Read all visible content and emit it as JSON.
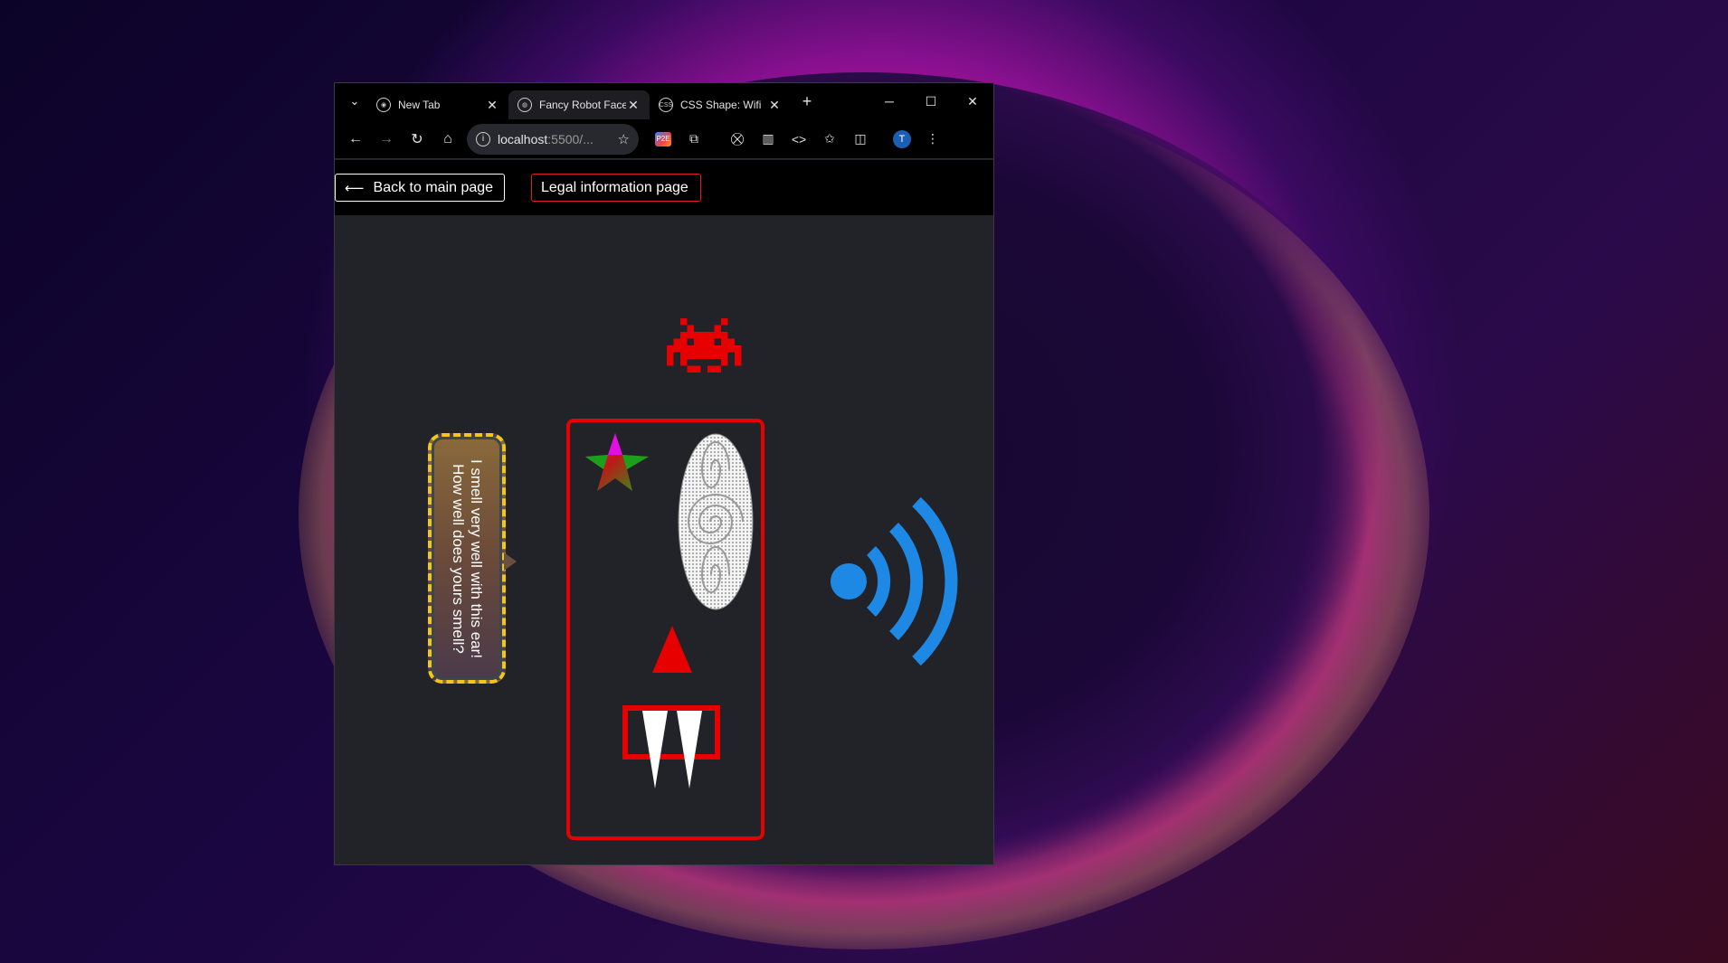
{
  "browser": {
    "tabs": [
      {
        "label": "New Tab",
        "favicon": "chrome-icon",
        "active": false
      },
      {
        "label": "Fancy Robot Face",
        "favicon": "globe-icon",
        "active": true
      },
      {
        "label": "CSS Shape: Wifi",
        "favicon": "css-icon",
        "active": false
      }
    ],
    "address": {
      "host": "localhost",
      "rest": ":5500/..."
    },
    "profile_initial": "T",
    "extension_badge": "P2E"
  },
  "page": {
    "back_button": "Back to main page",
    "back_arrow": "⟵",
    "legal_button": "Legal information page",
    "speech_bubble_text": "I smell very well with this ear! How well does yours smell?"
  },
  "colors": {
    "accent_red": "#e60000",
    "wifi_blue": "#1e88e5",
    "bubble_border": "#f5c518",
    "page_bg": "#222329"
  }
}
